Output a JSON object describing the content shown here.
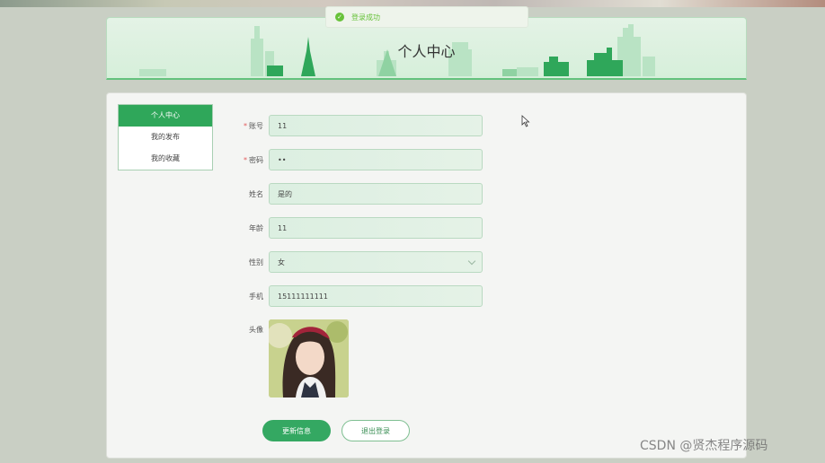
{
  "toast": {
    "message": "登录成功",
    "icon": "check-circle-icon",
    "color": "#67c23a"
  },
  "header": {
    "title": "个人中心"
  },
  "menu": {
    "items": [
      {
        "label": "个人中心",
        "active": true
      },
      {
        "label": "我的发布",
        "active": false
      },
      {
        "label": "我的收藏",
        "active": false
      }
    ]
  },
  "form": {
    "account": {
      "label": "账号",
      "required": true,
      "value": "11"
    },
    "password": {
      "label": "密码",
      "required": true,
      "value": "••"
    },
    "name": {
      "label": "姓名",
      "value": "是的"
    },
    "age": {
      "label": "年龄",
      "value": "11"
    },
    "gender": {
      "label": "性别",
      "value": "女"
    },
    "phone": {
      "label": "手机",
      "value": "15111111111"
    },
    "avatar": {
      "label": "头像"
    }
  },
  "buttons": {
    "update": "更新信息",
    "logout": "退出登录"
  },
  "watermark": "CSDN @贤杰程序源码",
  "colors": {
    "primary": "#34a862",
    "accent_light": "#dcefe1"
  }
}
